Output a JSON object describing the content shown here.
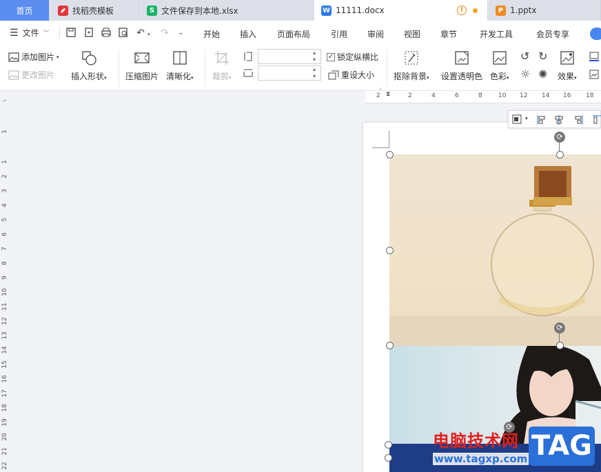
{
  "tabs": [
    {
      "label": "首页",
      "icon": "home-tab"
    },
    {
      "label": "找稻壳模板",
      "icon": "docer-icon",
      "badge": ""
    },
    {
      "label": "文件保存到本地.xlsx",
      "icon": "spreadsheet-icon",
      "badge": "S"
    },
    {
      "label": "11111.docx",
      "icon": "writer-icon",
      "badge": "W"
    },
    {
      "label": "1.pptx",
      "icon": "presentation-icon",
      "badge": "P"
    }
  ],
  "menu": {
    "file": "文件",
    "tabs": [
      "开始",
      "插入",
      "页面布局",
      "引用",
      "审阅",
      "视图",
      "章节",
      "开发工具",
      "会员专享"
    ]
  },
  "ribbon": {
    "add_picture": "添加图片",
    "change_picture": "更改图片",
    "insert_shape": "插入形状",
    "compress_picture": "压缩图片",
    "sharpen": "清晰化",
    "crop": "裁剪",
    "lock_ratio": "锁定纵横比",
    "reset_size": "重设大小",
    "remove_background": "抠除背景",
    "set_transparent": "设置透明色",
    "color": "色彩",
    "effects": "效果",
    "width_value": "",
    "height_value": ""
  },
  "ruler": {
    "h_numbers": [
      "2",
      "2",
      "4",
      "6",
      "8",
      "10",
      "12",
      "14",
      "16",
      "18"
    ],
    "v_numbers": [
      "1",
      "1",
      "2",
      "3",
      "4",
      "5",
      "6",
      "7",
      "8",
      "9",
      "10",
      "11",
      "12",
      "13",
      "14",
      "15",
      "16",
      "17",
      "18",
      "19",
      "20",
      "21",
      "22"
    ]
  },
  "watermark": {
    "cn": "电脑技术网",
    "url": "www.tagxp.com",
    "tag": "TAG"
  },
  "colors": {
    "accent": "#5b8def",
    "writer": "#2b79e6",
    "spreadsheet": "#1eb26a",
    "docer": "#e0353b",
    "presentation": "#f08a24"
  }
}
